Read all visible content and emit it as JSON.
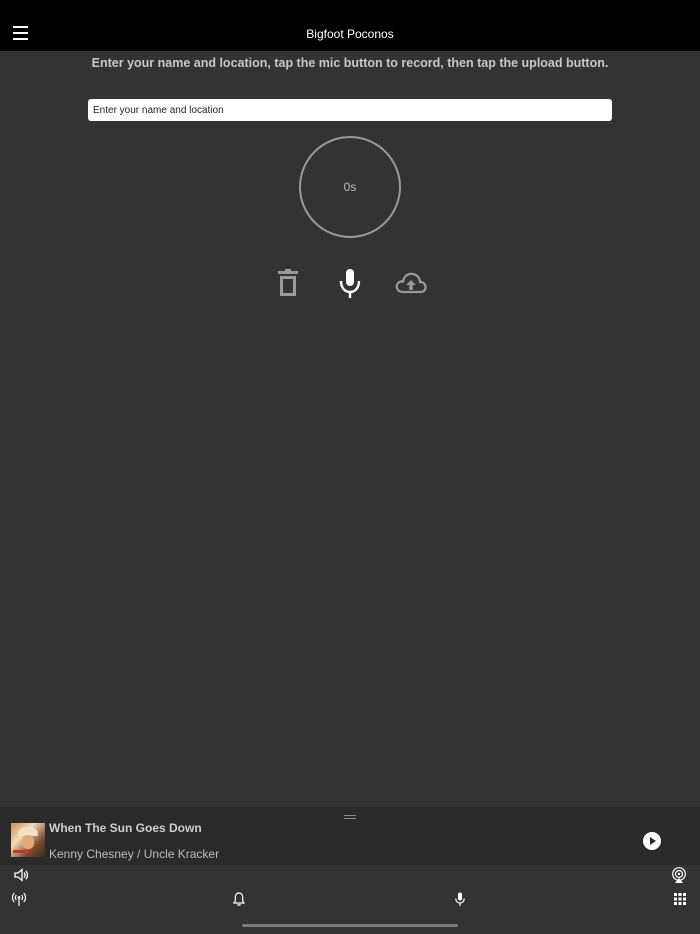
{
  "header": {
    "title": "Bigfoot Poconos"
  },
  "recorder": {
    "instructions": "Enter your name and location, tap the mic button to record, then tap the upload button.",
    "name_placeholder": "Enter your name and location",
    "name_value": "",
    "timer": "0s"
  },
  "controls": {
    "delete_icon": "trash-icon",
    "record_icon": "microphone-icon",
    "upload_icon": "cloud-upload-icon"
  },
  "now_playing": {
    "song_title": "When The Sun Goes Down",
    "artist": "Kenny Chesney / Uncle Kracker",
    "play_icon": "play-circle-icon"
  },
  "bottom_nav": {
    "volume_icon": "speaker-volume-icon",
    "airplay_icon": "airplay-icon",
    "podcast_icon": "broadcast-icon",
    "notifications_icon": "bell-icon",
    "mic_icon": "microphone-icon",
    "grid_icon": "grid-icon"
  },
  "colors": {
    "background": "#333333",
    "header_bg": "#000000",
    "player_bg": "#2a2a2a",
    "text": "#cfcfcf"
  }
}
